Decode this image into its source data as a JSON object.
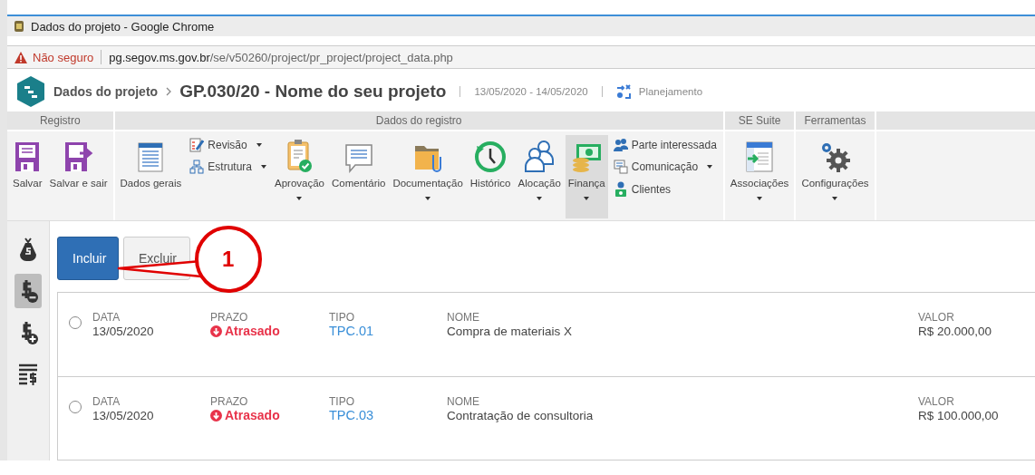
{
  "window": {
    "title": "Dados do projeto - Google Chrome"
  },
  "address_bar": {
    "security": "Não seguro",
    "host": "pg.segov.ms.gov.br",
    "path": "/se/v50260/project/pr_project/project_data.php"
  },
  "header": {
    "breadcrumb": "Dados do projeto",
    "title": "GP.030/20 - Nome do seu projeto",
    "dates": "13/05/2020 - 14/05/2020",
    "status": "Planejamento"
  },
  "ribbon": {
    "groups": [
      {
        "label": "Registro",
        "items": [
          {
            "kind": "large",
            "label": "Salvar",
            "dropdown": false,
            "selected": false
          },
          {
            "kind": "large",
            "label": "Salvar e sair",
            "dropdown": false,
            "selected": false
          }
        ]
      },
      {
        "label": "Dados do registro",
        "items": [
          {
            "kind": "large",
            "label": "Dados gerais",
            "dropdown": false,
            "selected": false
          },
          {
            "kind": "stack",
            "entries": [
              {
                "label": "Revisão",
                "dropdown": true
              },
              {
                "label": "Estrutura",
                "dropdown": true
              }
            ]
          },
          {
            "kind": "large",
            "label": "Aprovação",
            "dropdown": true,
            "selected": false
          },
          {
            "kind": "large",
            "label": "Comentário",
            "dropdown": false,
            "selected": false
          },
          {
            "kind": "large",
            "label": "Documentação",
            "dropdown": true,
            "selected": false
          },
          {
            "kind": "large",
            "label": "Histórico",
            "dropdown": false,
            "selected": false
          },
          {
            "kind": "large",
            "label": "Alocação",
            "dropdown": true,
            "selected": false
          },
          {
            "kind": "large",
            "label": "Finança",
            "dropdown": true,
            "selected": true
          },
          {
            "kind": "stack",
            "entries": [
              {
                "label": "Parte interessada",
                "dropdown": false
              },
              {
                "label": "Comunicação",
                "dropdown": true
              },
              {
                "label": "Clientes",
                "dropdown": false
              }
            ]
          }
        ]
      },
      {
        "label": "SE Suite",
        "items": [
          {
            "kind": "large",
            "label": "Associações",
            "dropdown": true,
            "selected": false
          }
        ]
      },
      {
        "label": "Ferramentas",
        "items": [
          {
            "kind": "large",
            "label": "Configurações",
            "dropdown": true,
            "selected": false
          }
        ]
      }
    ]
  },
  "sidebar": {
    "items": [
      {
        "selected": false
      },
      {
        "selected": true
      },
      {
        "selected": false
      },
      {
        "selected": false
      }
    ]
  },
  "buttons": [
    {
      "label": "Incluir",
      "kind": "primary"
    },
    {
      "label": "Excluir",
      "kind": "default"
    }
  ],
  "annotation": {
    "number": "1"
  },
  "rows": [
    {
      "selected": false,
      "date_label": "DATA",
      "date": "13/05/2020",
      "deadline_label": "PRAZO",
      "deadline": "Atrasado",
      "type_label": "TIPO",
      "type": "TPC.01",
      "name_label": "NOME",
      "name": "Compra de materiais X",
      "value_label": "VALOR",
      "value": "R$ 20.000,00"
    },
    {
      "selected": false,
      "date_label": "DATA",
      "date": "13/05/2020",
      "deadline_label": "PRAZO",
      "deadline": "Atrasado",
      "type_label": "TIPO",
      "type": "TPC.03",
      "name_label": "NOME",
      "name": "Contratação de consultoria",
      "value_label": "VALOR",
      "value": "R$ 100.000,00"
    }
  ]
}
